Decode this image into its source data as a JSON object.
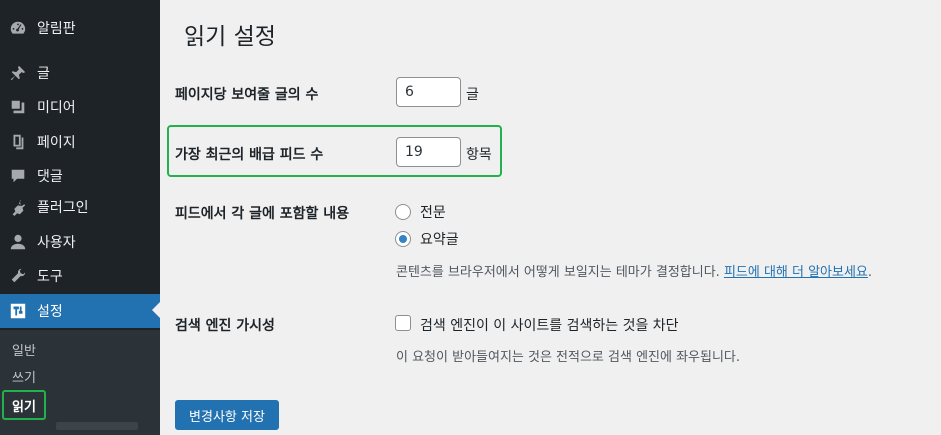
{
  "sidebar": {
    "items": [
      {
        "label": "알림판",
        "icon": "dashboard-icon"
      },
      {
        "label": "글",
        "icon": "pin-icon"
      },
      {
        "label": "미디어",
        "icon": "media-icon"
      },
      {
        "label": "페이지",
        "icon": "page-icon"
      },
      {
        "label": "댓글",
        "icon": "comment-icon"
      },
      {
        "label": "플러그인",
        "icon": "plugin-icon"
      },
      {
        "label": "사용자",
        "icon": "user-icon"
      },
      {
        "label": "도구",
        "icon": "wrench-icon"
      },
      {
        "label": "설정",
        "icon": "settings-icon"
      }
    ],
    "submenu": [
      "일반",
      "쓰기",
      "읽기"
    ]
  },
  "page": {
    "title": "읽기 설정",
    "posts_per_page": {
      "label": "페이지당 보여줄 글의 수",
      "value": "6",
      "unit": "글"
    },
    "feed_items": {
      "label": "가장 최근의 배급 피드 수",
      "value": "19",
      "unit": "항목"
    },
    "feed_content": {
      "label": "피드에서 각 글에 포함할 내용",
      "option_full": "전문",
      "option_excerpt": "요약글",
      "selected": "요약글",
      "description": "콘텐츠를 브라우저에서 어떻게 보일지는 테마가 결정합니다. ",
      "link": "피드에 대해 더 알아보세요",
      "description_end": "."
    },
    "search_visibility": {
      "label": "검색 엔진 가시성",
      "checkbox_label": "검색 엔진이 이 사이트를 검색하는 것을 차단",
      "checked": false,
      "description": "이 요청이 받아들여지는 것은 전적으로 검색 엔진에 좌우됩니다."
    },
    "save_button": "변경사항 저장"
  },
  "colors": {
    "sidebar_bg": "#1d2327",
    "accent": "#2271b1",
    "highlight": "#22b14c"
  }
}
